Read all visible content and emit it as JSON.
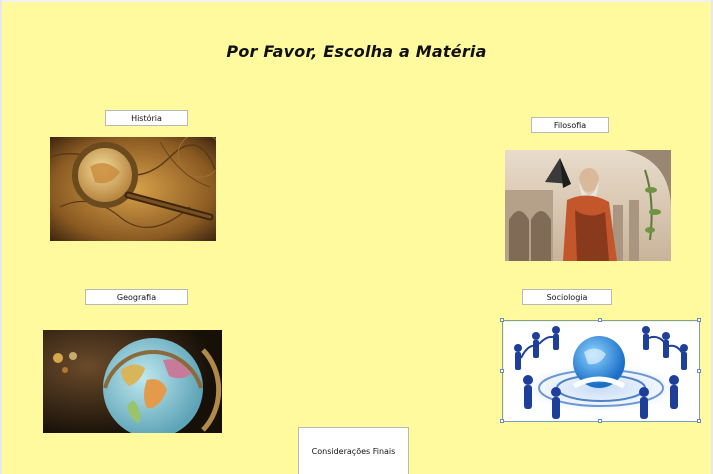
{
  "page": {
    "title": "Por Favor, Escolha a Matéria"
  },
  "buttons": {
    "historia": "História",
    "filosofia": "Filosofia",
    "geografia": "Geografia",
    "sociologia": "Sociologia",
    "consideracoes": "Considerações Finais"
  },
  "images": {
    "historia": "magnifying-glass-over-antique-map",
    "filosofia": "classical-philosopher-fresco-with-pyramid",
    "geografia": "desk-globe",
    "sociologia": "people-holding-hands-around-globe"
  },
  "colors": {
    "background": "#fffa9e",
    "button_bg": "#ffffff",
    "selection": "#7a9ccc"
  }
}
